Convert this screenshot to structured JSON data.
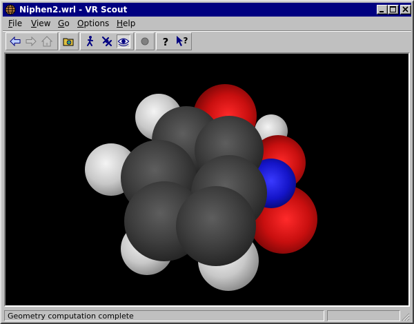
{
  "window": {
    "title": "Niphen2.wrl - VR Scout",
    "icon": "vr-scout-globe-icon"
  },
  "menu": {
    "items": [
      {
        "label_first": "F",
        "label_rest": "ile"
      },
      {
        "label_first": "V",
        "label_rest": "iew"
      },
      {
        "label_first": "G",
        "label_rest": "o"
      },
      {
        "label_first": "O",
        "label_rest": "ptions"
      },
      {
        "label_first": "H",
        "label_rest": "elp"
      }
    ]
  },
  "toolbar": {
    "buttons": [
      {
        "icon": "back-arrow-icon"
      },
      {
        "icon": "forward-arrow-icon"
      },
      {
        "icon": "home-icon"
      },
      {
        "icon": "open-file-icon"
      },
      {
        "icon": "walk-icon"
      },
      {
        "icon": "fly-icon"
      },
      {
        "icon": "examine-eye-icon"
      },
      {
        "icon": "stop-icon"
      },
      {
        "icon": "help-icon"
      },
      {
        "icon": "context-help-icon"
      }
    ],
    "active_mode": "examine"
  },
  "scene": {
    "description_colors": {
      "carbon": "#3c3c3c",
      "hydrogen": "#dcdcdc",
      "oxygen": "#e01010",
      "nitrogen": "#1010e0",
      "background": "#000000"
    }
  },
  "status": {
    "message": "Geometry computation complete"
  }
}
